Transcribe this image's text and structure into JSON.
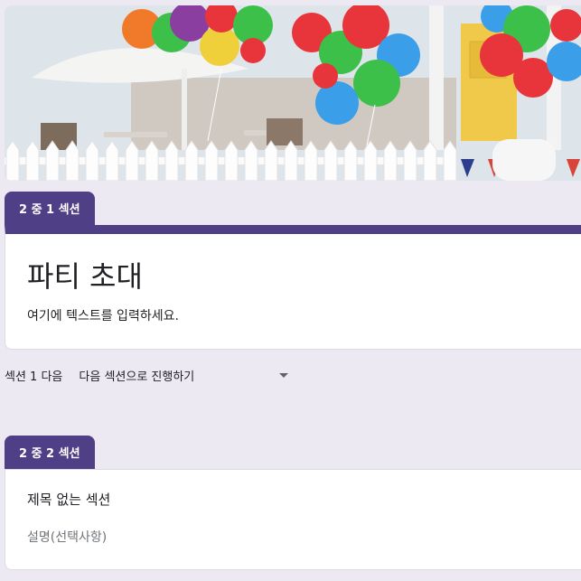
{
  "section1": {
    "tab_label": "2 중 1 섹션",
    "title": "파티 초대",
    "description": "여기에 텍스트를 입력하세요."
  },
  "after_section": {
    "label": "섹션 1 다음",
    "selected_value": "다음 섹션으로 진행하기"
  },
  "section2": {
    "tab_label": "2 중 2 섹션",
    "title": "제목 없는 섹션",
    "description_placeholder": "설명(선택사항)"
  },
  "colors": {
    "accent": "#4f3f86",
    "background": "#ece9f3"
  }
}
